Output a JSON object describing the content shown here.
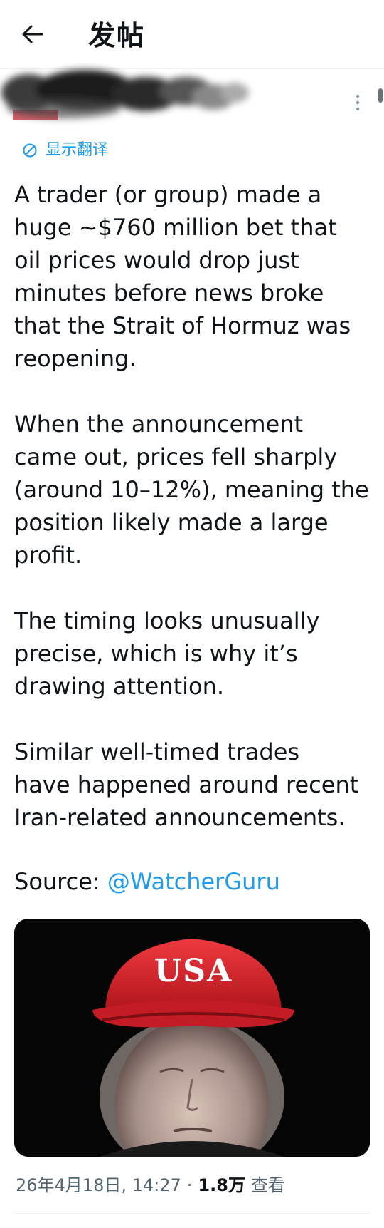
{
  "header": {
    "title": "发帖",
    "back_icon": "arrow-left-icon"
  },
  "translate": {
    "label": "显示翻译",
    "icon": "translate-icon"
  },
  "post": {
    "body": "A trader (or group) made a\nhuge ~$760 million bet that\noil prices would drop just\nminutes before news broke\nthat the Strait of Hormuz was\nreopening.\n\nWhen the announcement\ncame out, prices fell sharply\n(around 10–12%), meaning the\nposition likely made a large\nprofit.\n\nThe timing looks unusually\nprecise, which is why it’s\ndrawing attention.\n\nSimilar well-timed trades\nhave happened around recent\nIran-related announcements.",
    "source_label": "Source: ",
    "source_mention": "@WatcherGuru",
    "hat_text": "USA"
  },
  "meta": {
    "date_time": "26年4月18日, 14:27",
    "separator": "·",
    "views_count": "1.8万",
    "views_label": "查看"
  },
  "colors": {
    "accent": "#1d9bf0",
    "text": "#0f1419",
    "muted": "#536471",
    "hat_red": "#d9232b"
  }
}
